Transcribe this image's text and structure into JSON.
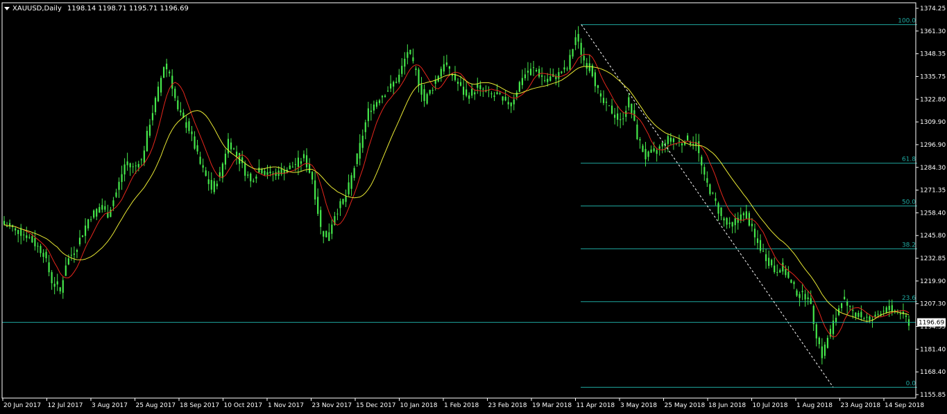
{
  "header": {
    "symbol_tf": "XAUUSD,Daily",
    "ohlc": "1198.14 1198.71 1195.71 1196.69"
  },
  "colors": {
    "background": "#000000",
    "candles": "#45e84b",
    "ma_fast": "#e6261c",
    "ma_slow": "#e8e833",
    "fib": "#1fa8a0",
    "price_line": "#1fa8a0",
    "trend": "#ffffff",
    "axis": "#ffffff"
  },
  "chart_data": {
    "type": "candlestick",
    "symbol": "XAUUSD",
    "timeframe": "Daily",
    "last_ohlc": {
      "open": 1198.14,
      "high": 1198.71,
      "low": 1195.71,
      "close": 1196.69
    },
    "current_price": "1196.69",
    "y_axis": {
      "range": [
        1155.85,
        1374.25
      ],
      "ticks": [
        "1374.25",
        "1361.30",
        "1348.35",
        "1335.75",
        "1322.80",
        "1309.90",
        "1296.90",
        "1284.30",
        "1271.35",
        "1258.40",
        "1245.80",
        "1232.85",
        "1219.90",
        "1207.30",
        "1194.35",
        "1181.40",
        "1168.40",
        "1155.85"
      ]
    },
    "x_axis": {
      "labels": [
        "20 Jun 2017",
        "12 Jul 2017",
        "3 Aug 2017",
        "25 Aug 2017",
        "18 Sep 2017",
        "10 Oct 2017",
        "1 Nov 2017",
        "23 Nov 2017",
        "15 Dec 2017",
        "10 Jan 2018",
        "1 Feb 2018",
        "23 Feb 2018",
        "19 Mar 2018",
        "11 Apr 2018",
        "3 May 2018",
        "25 May 2018",
        "18 Jun 2018",
        "10 Jul 2018",
        "1 Aug 2018",
        "23 Aug 2018",
        "14 Sep 2018"
      ]
    },
    "fibonacci": {
      "high": 1365.0,
      "low": 1160.0,
      "levels": [
        {
          "label": "100.0",
          "ratio": 1.0
        },
        {
          "label": "61.8",
          "ratio": 0.618
        },
        {
          "label": "50.0",
          "ratio": 0.5
        },
        {
          "label": "38.2",
          "ratio": 0.382
        },
        {
          "label": "23.6",
          "ratio": 0.236
        },
        {
          "label": "0.0",
          "ratio": 0.0
        }
      ]
    },
    "close_path": [
      [
        0,
        1252
      ],
      [
        8,
        1246
      ],
      [
        14,
        1236
      ],
      [
        17,
        1220
      ],
      [
        20,
        1214
      ],
      [
        22,
        1230
      ],
      [
        26,
        1240
      ],
      [
        30,
        1255
      ],
      [
        34,
        1262
      ],
      [
        37,
        1258
      ],
      [
        40,
        1270
      ],
      [
        43,
        1286
      ],
      [
        46,
        1284
      ],
      [
        49,
        1288
      ],
      [
        52,
        1310
      ],
      [
        55,
        1328
      ],
      [
        57,
        1342
      ],
      [
        59,
        1338
      ],
      [
        62,
        1316
      ],
      [
        66,
        1306
      ],
      [
        70,
        1286
      ],
      [
        74,
        1272
      ],
      [
        77,
        1280
      ],
      [
        80,
        1300
      ],
      [
        84,
        1288
      ],
      [
        88,
        1276
      ],
      [
        91,
        1284
      ],
      [
        95,
        1280
      ],
      [
        99,
        1282
      ],
      [
        103,
        1285
      ],
      [
        107,
        1290
      ],
      [
        110,
        1278
      ],
      [
        113,
        1250
      ],
      [
        115,
        1244
      ],
      [
        118,
        1258
      ],
      [
        122,
        1268
      ],
      [
        126,
        1290
      ],
      [
        130,
        1316
      ],
      [
        134,
        1324
      ],
      [
        138,
        1330
      ],
      [
        141,
        1336
      ],
      [
        144,
        1350
      ],
      [
        147,
        1338
      ],
      [
        150,
        1322
      ],
      [
        153,
        1330
      ],
      [
        157,
        1344
      ],
      [
        161,
        1334
      ],
      [
        165,
        1324
      ],
      [
        169,
        1330
      ],
      [
        173,
        1326
      ],
      [
        177,
        1324
      ],
      [
        181,
        1320
      ],
      [
        185,
        1336
      ],
      [
        189,
        1340
      ],
      [
        193,
        1334
      ],
      [
        197,
        1336
      ],
      [
        201,
        1340
      ],
      [
        204,
        1358
      ],
      [
        207,
        1345
      ],
      [
        210,
        1338
      ],
      [
        213,
        1322
      ],
      [
        217,
        1316
      ],
      [
        220,
        1310
      ],
      [
        223,
        1322
      ],
      [
        226,
        1302
      ],
      [
        229,
        1290
      ],
      [
        233,
        1294
      ],
      [
        237,
        1300
      ],
      [
        240,
        1298
      ],
      [
        244,
        1300
      ],
      [
        247,
        1298
      ],
      [
        250,
        1278
      ],
      [
        253,
        1268
      ],
      [
        256,
        1256
      ],
      [
        259,
        1250
      ],
      [
        262,
        1256
      ],
      [
        265,
        1258
      ],
      [
        268,
        1244
      ],
      [
        271,
        1236
      ],
      [
        275,
        1226
      ],
      [
        278,
        1228
      ],
      [
        281,
        1218
      ],
      [
        284,
        1212
      ],
      [
        287,
        1212
      ],
      [
        290,
        1190
      ],
      [
        292,
        1178
      ],
      [
        294,
        1188
      ],
      [
        297,
        1200
      ],
      [
        299,
        1210
      ],
      [
        302,
        1204
      ],
      [
        306,
        1200
      ],
      [
        310,
        1198
      ],
      [
        314,
        1204
      ],
      [
        317,
        1204
      ],
      [
        320,
        1202
      ],
      [
        323,
        1196.69
      ]
    ]
  }
}
